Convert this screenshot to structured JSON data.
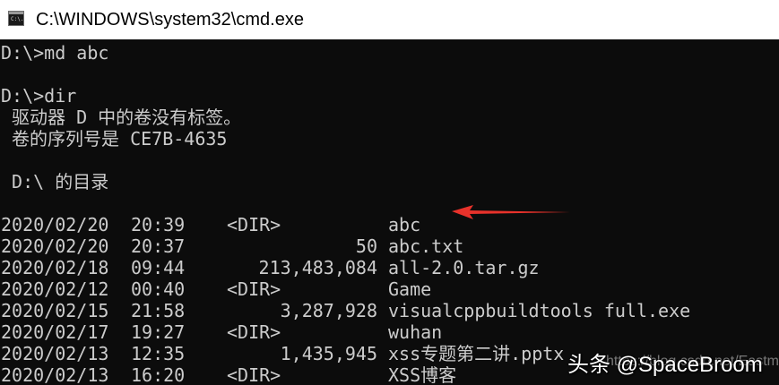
{
  "window": {
    "title": "C:\\WINDOWS\\system32\\cmd.exe",
    "icon": "cmd-console-icon",
    "icon_glyph": "C:\\."
  },
  "console": {
    "lines": [
      "D:\\>md abc",
      "",
      "D:\\>dir",
      " 驱动器 D 中的卷没有标签。",
      " 卷的序列号是 CE7B-4635",
      "",
      " D:\\ 的目录",
      ""
    ],
    "listing": [
      {
        "date": "2020/02/20",
        "time": "20:39",
        "dir": "<DIR>",
        "size": "",
        "name": "abc"
      },
      {
        "date": "2020/02/20",
        "time": "20:37",
        "dir": "",
        "size": "50",
        "name": "abc.txt"
      },
      {
        "date": "2020/02/18",
        "time": "09:44",
        "dir": "",
        "size": "213,483,084",
        "name": "all-2.0.tar.gz"
      },
      {
        "date": "2020/02/12",
        "time": "00:40",
        "dir": "<DIR>",
        "size": "",
        "name": "Game"
      },
      {
        "date": "2020/02/15",
        "time": "21:58",
        "dir": "",
        "size": "3,287,928",
        "name": "visualcppbuildtools full.exe"
      },
      {
        "date": "2020/02/17",
        "time": "19:27",
        "dir": "<DIR>",
        "size": "",
        "name": "wuhan"
      },
      {
        "date": "2020/02/13",
        "time": "12:35",
        "dir": "",
        "size": "1,435,945",
        "name": "xss专题第二讲.pptx"
      },
      {
        "date": "2020/02/13",
        "time": "16:20",
        "dir": "<DIR>",
        "size": "",
        "name": "XSS博客"
      }
    ],
    "text_color": "#cccccc",
    "background": "#0c0c0c"
  },
  "annotation": {
    "arrow_color": "#e8322b"
  },
  "watermark": {
    "text": "头条 @SpaceBroom",
    "url": "https://blog.csdn.net/Eastmount"
  }
}
